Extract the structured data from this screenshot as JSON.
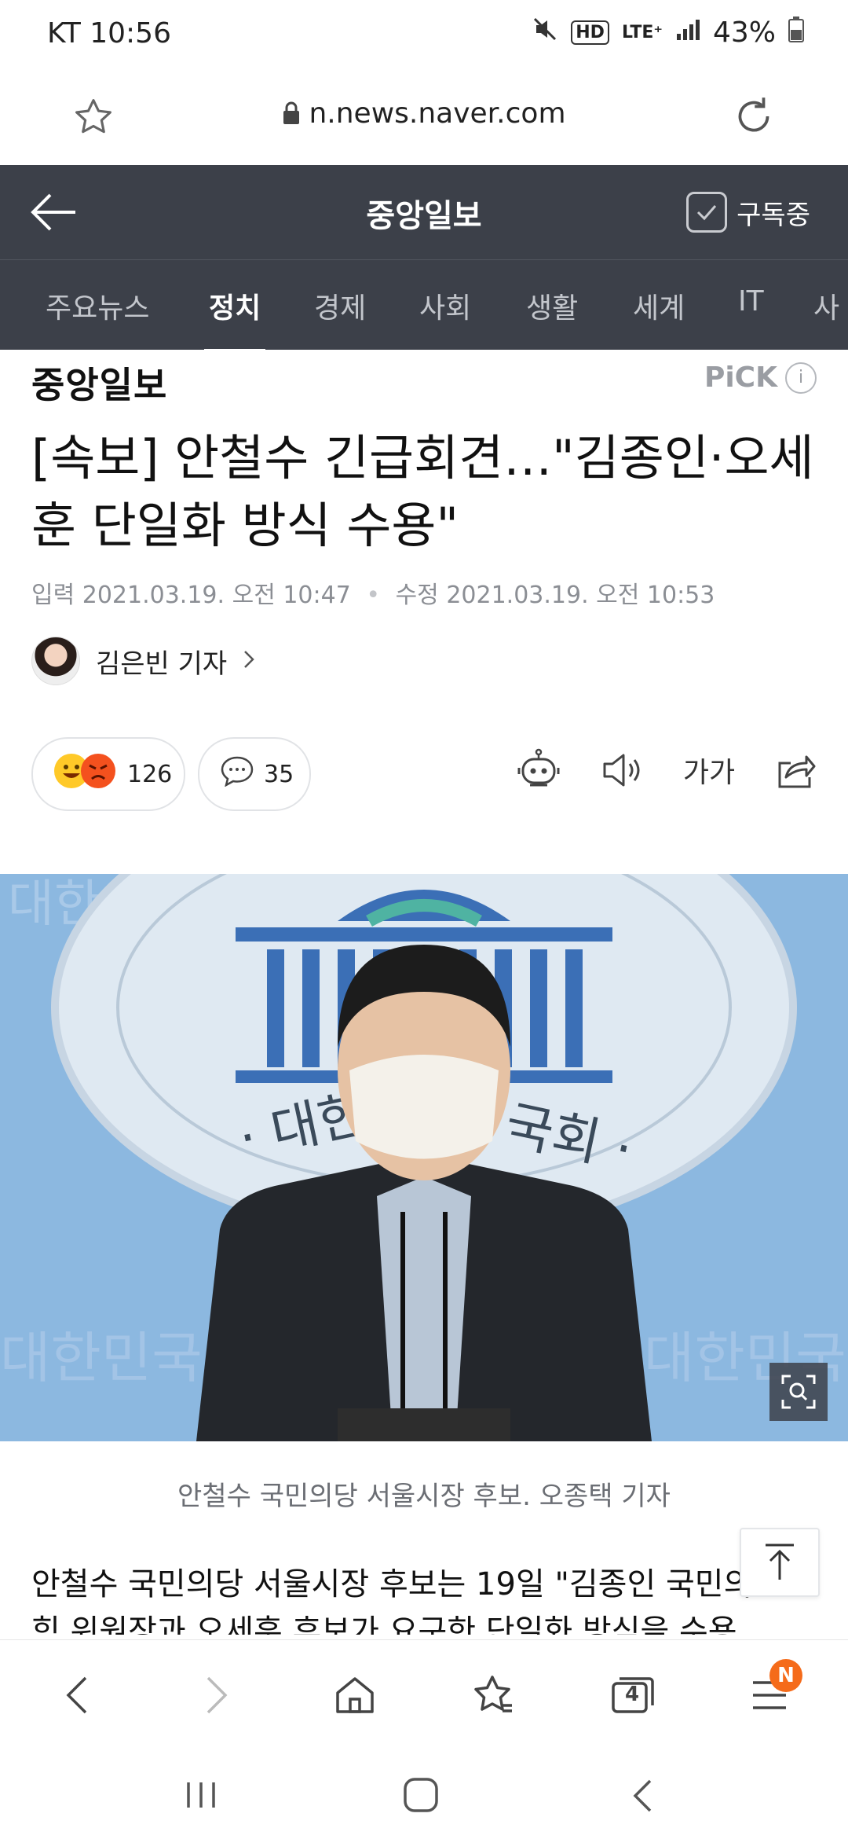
{
  "status": {
    "carrier_time": "KT 10:56",
    "lte": "LTE⁺",
    "hd": "HD",
    "battery": "43%"
  },
  "browser": {
    "url": "n.news.naver.com",
    "tab_count": "4",
    "menu_badge": "N"
  },
  "press": {
    "name": "중앙일보",
    "subscribe_label": "구독중"
  },
  "tabs": [
    "주요뉴스",
    "정치",
    "경제",
    "사회",
    "생활",
    "세계",
    "IT",
    "사"
  ],
  "active_tab": "정치",
  "article": {
    "logo": "중앙일보",
    "pick_label": "PiCK",
    "headline": "[속보] 안철수 긴급회견…\"김종인·오세훈 단일화 방식 수용\"",
    "input_label": "입력",
    "input_date": "2021.03.19. 오전 10:47",
    "edit_label": "수정",
    "edit_date": "2021.03.19. 오전 10:53",
    "reporter": "김은빈 기자",
    "reaction_count": "126",
    "comment_count": "35",
    "font_size_label": "가가",
    "photo_caption": "안철수 국민의당 서울시장 후보. 오종택 기자",
    "body_line1": "안철수 국민의당 서울시장 후보는 19일 \"김종인 국민의",
    "body_line2": "힘 위원장과 오세훈 후보가 요구한 단일화 방식을 수용"
  },
  "colors": {
    "header_bg": "#3c4049",
    "badge": "#f56b1a",
    "text": "#111111"
  }
}
